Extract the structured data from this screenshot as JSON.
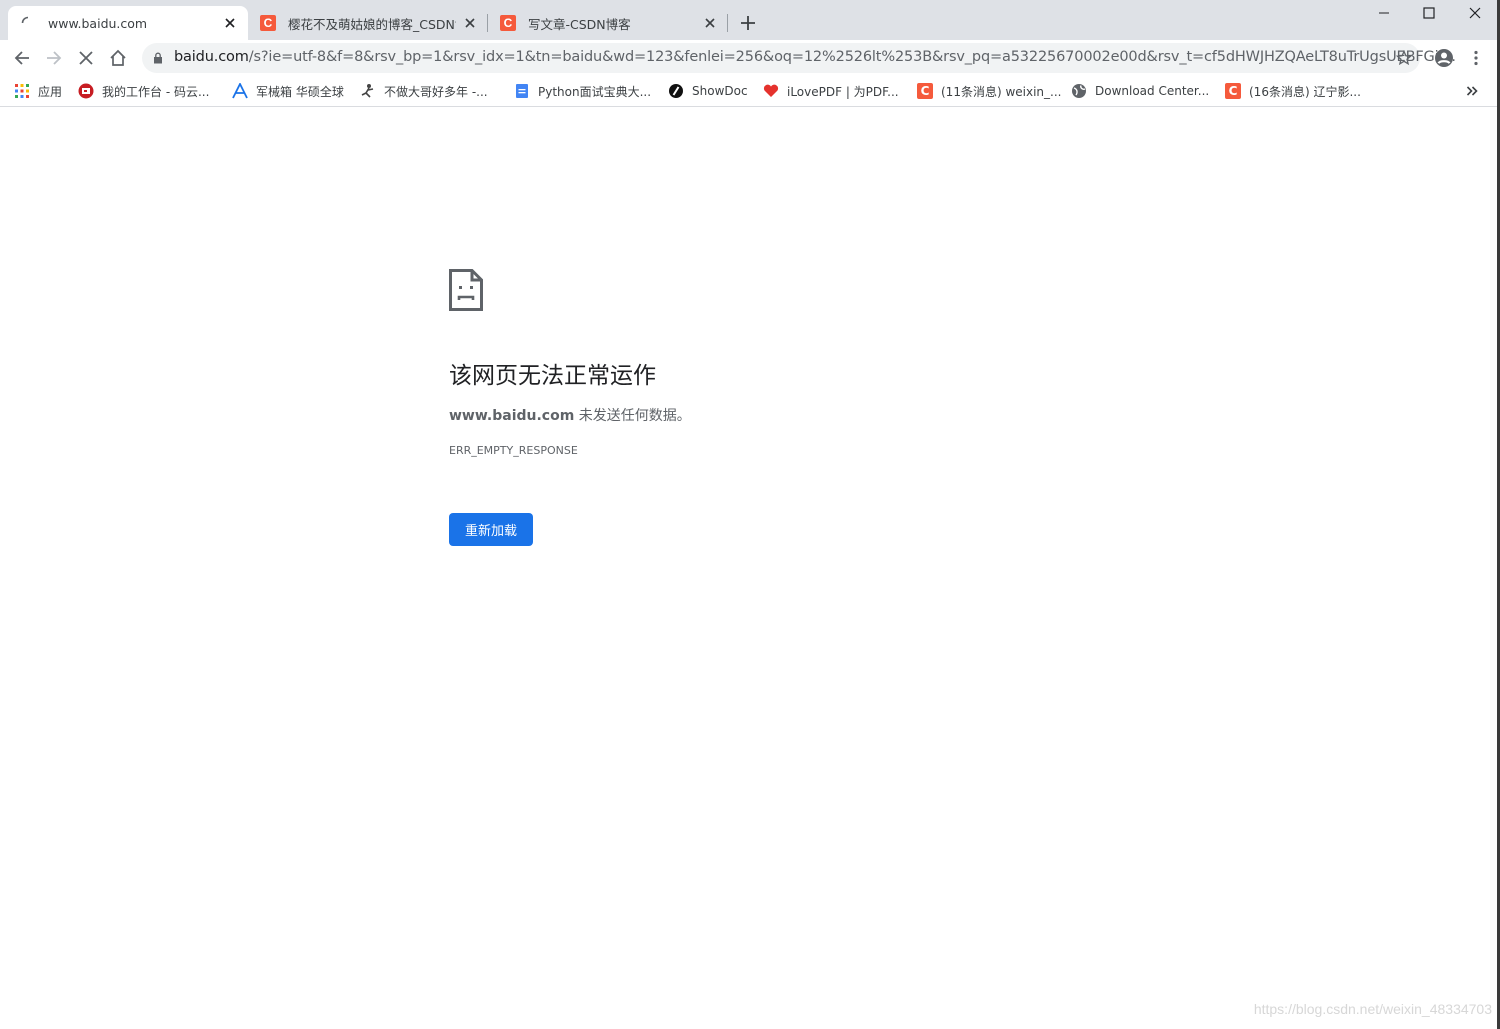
{
  "tabs": [
    {
      "title": "www.baidu.com",
      "favicon": "loading-spinner-icon",
      "active": true
    },
    {
      "title": "樱花不及萌姑娘的博客_CSDN博",
      "favicon": "csdn-icon",
      "active": false
    },
    {
      "title": "写文章-CSDN博客",
      "favicon": "csdn-icon",
      "active": false
    }
  ],
  "csdn_letter": "C",
  "toolbar": {
    "url_host": "baidu.com",
    "url_rest": "/s?ie=utf-8&f=8&rsv_bp=1&rsv_idx=1&tn=baidu&wd=123&fenlei=256&oq=12%2526lt%253B&rsv_pq=a53225670002e00d&rsv_t=cf5dHWJHZQAeLT8uTrUgsUEBFGil..."
  },
  "bookmarks": [
    {
      "label": "应用",
      "icon": "apps-grid-icon"
    },
    {
      "label": "我的工作台 - 码云...",
      "icon": "gitee-icon"
    },
    {
      "label": "军械箱 华硕全球",
      "icon": "asus-icon"
    },
    {
      "label": "不做大哥好多年 -...",
      "icon": "jump-icon"
    },
    {
      "label": "Python面试宝典大...",
      "icon": "doc-icon"
    },
    {
      "label": "ShowDoc",
      "icon": "showdoc-icon"
    },
    {
      "label": "iLovePDF | 为PDF...",
      "icon": "heart-icon"
    },
    {
      "label": "(11条消息) weixin_...",
      "icon": "csdn-icon"
    },
    {
      "label": "Download Center...",
      "icon": "globe-icon"
    },
    {
      "label": "(16条消息) 辽宁影...",
      "icon": "csdn-icon"
    }
  ],
  "error": {
    "title": "该网页无法正常运作",
    "host": "www.baidu.com",
    "message": " 未发送任何数据。",
    "code": "ERR_EMPTY_RESPONSE",
    "reload_label": "重新加载"
  },
  "watermark": "https://blog.csdn.net/weixin_48334703",
  "colors": {
    "accent": "#1a73e8",
    "tabstrip": "#dee1e6",
    "csdn": "#f55a3c"
  }
}
